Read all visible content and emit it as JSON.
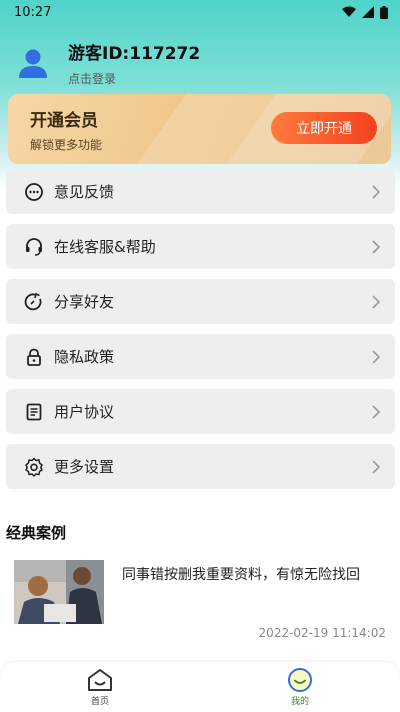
{
  "status_bar": {
    "time": "10:27"
  },
  "profile": {
    "name": "游客ID:117272",
    "login_hint": "点击登录"
  },
  "vip": {
    "title": "开通会员",
    "subtitle": "解锁更多功能",
    "button": "立即开通"
  },
  "menu": [
    {
      "label": "意见反馈",
      "icon": "feedback-icon"
    },
    {
      "label": "在线客服&帮助",
      "icon": "headset-icon"
    },
    {
      "label": "分享好友",
      "icon": "share-icon"
    },
    {
      "label": "隐私政策",
      "icon": "lock-icon"
    },
    {
      "label": "用户协议",
      "icon": "document-icon"
    },
    {
      "label": "更多设置",
      "icon": "gear-icon"
    }
  ],
  "cases": {
    "title": "经典案例",
    "items": [
      {
        "title": "同事错按删我重要资料，有惊无险找回",
        "date": "2022-02-19 11:14:02"
      }
    ]
  },
  "bottom_nav": [
    {
      "label": "首页",
      "active": false
    },
    {
      "label": "我的",
      "active": true
    }
  ],
  "colors": {
    "accent": "#4fd3c9",
    "vip_button": "#f4421f",
    "avatar": "#2f6fe0",
    "active_tab": "#3a8a3a"
  }
}
